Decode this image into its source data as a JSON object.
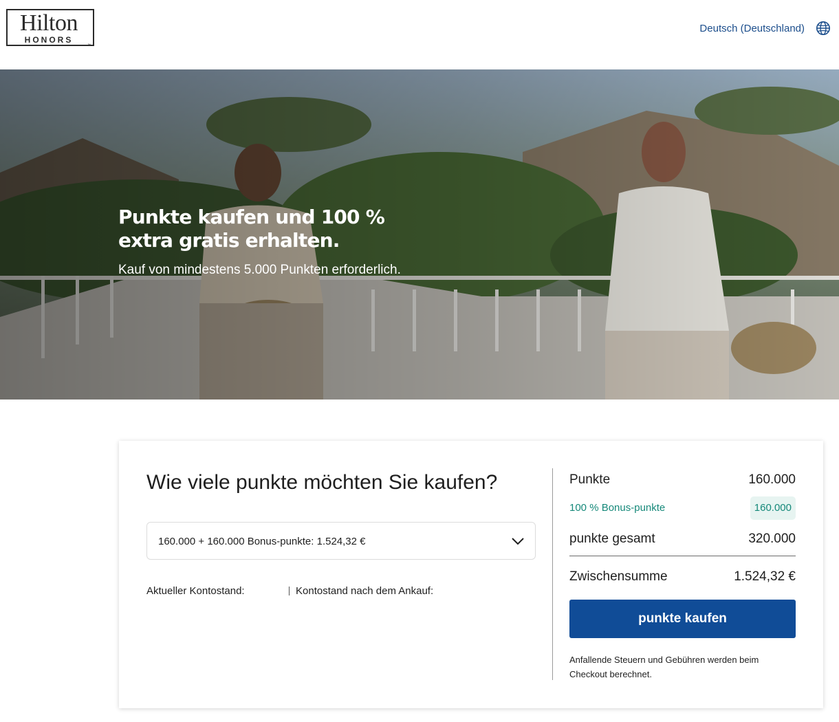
{
  "header": {
    "logo_text": "Hilton",
    "logo_sub": "HONORS",
    "logo_tm": "™",
    "language": "Deutsch (Deutschland)",
    "language_icon": "globe-icon"
  },
  "hero": {
    "title": "Punkte kaufen und 100 % extra gratis erhalten.",
    "subtitle": "Kauf von mindestens 5.000 Punkten erforderlich."
  },
  "purchase": {
    "title": "Wie viele punkte möchten Sie kaufen?",
    "select_value": "160.000 + 160.000 Bonus-punkte: 1.524,32 €",
    "select_icon": "chevron-down-icon",
    "current_balance_label": "Aktueller Kontostand:",
    "balance_after_label": "Kontostand nach dem Ankauf:"
  },
  "summary": {
    "points_label": "Punkte",
    "points_value": "160.000",
    "bonus_label": "100 % Bonus-punkte",
    "bonus_value": "160.000",
    "total_label": "punkte gesamt",
    "total_value": "320.000",
    "subtotal_label": "Zwischensumme",
    "subtotal_value": "1.524,32 €",
    "buy_button": "punkte kaufen",
    "note": "Anfallende Steuern und Gebühren werden beim Checkout berechnet."
  },
  "colors": {
    "accent": "#104c97",
    "link": "#1c4e8c",
    "bonus": "#16897a",
    "bonus_bg": "#e7f4f1"
  }
}
